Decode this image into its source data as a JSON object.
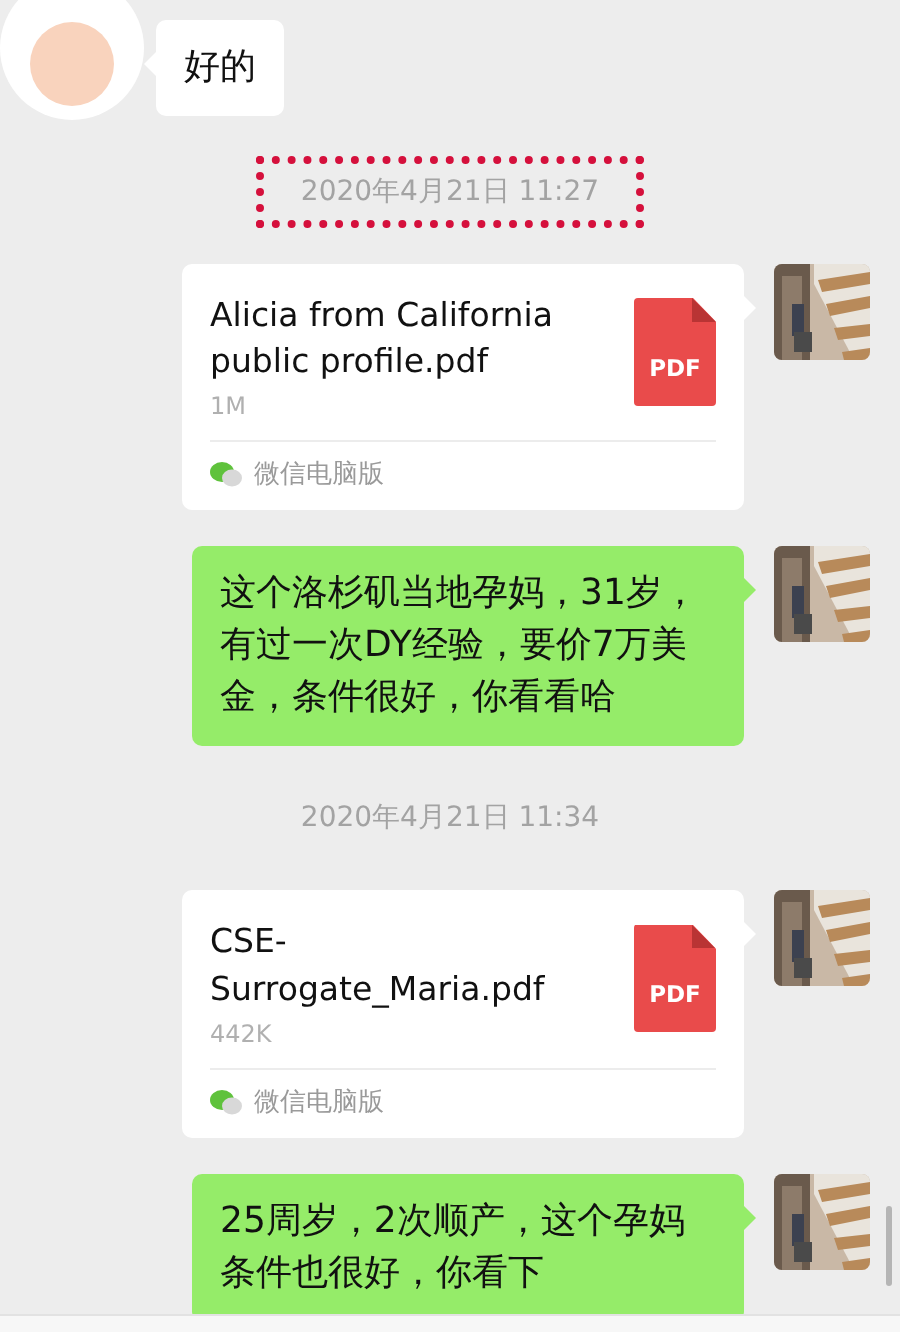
{
  "messages": [
    {
      "kind": "received",
      "text": "好的"
    },
    {
      "kind": "time",
      "text": "2020年4月21日 11:27",
      "highlighted": true
    },
    {
      "kind": "file",
      "name": "Alicia from California\npublic profile.pdf",
      "badge": "PDF",
      "size": "1M",
      "source": "微信电脑版"
    },
    {
      "kind": "sent",
      "text": "这个洛杉矶当地孕妈，31岁，有过一次DY经验，要价7万美金，条件很好，你看看哈"
    },
    {
      "kind": "time",
      "text": "2020年4月21日 11:34",
      "highlighted": false
    },
    {
      "kind": "file",
      "name": "CSE-\nSurrogate_Maria.pdf",
      "badge": "PDF",
      "size": "442K",
      "source": "微信电脑版"
    },
    {
      "kind": "sent",
      "text": "25周岁，2次顺产，这个孕妈条件也很好，你看下"
    }
  ]
}
